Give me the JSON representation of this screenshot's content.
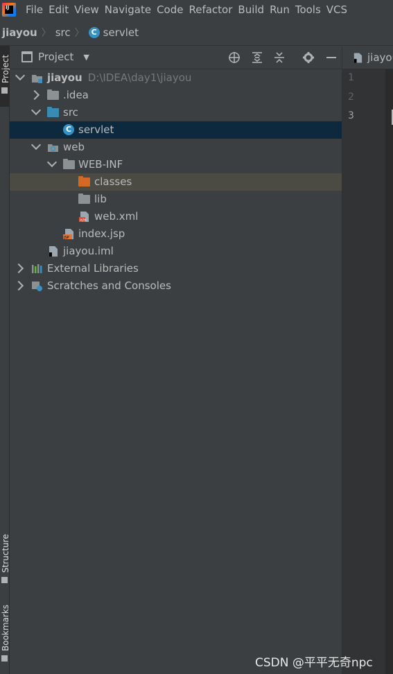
{
  "menubar": {
    "items": [
      {
        "label": "File"
      },
      {
        "label": "Edit"
      },
      {
        "label": "View"
      },
      {
        "label": "Navigate"
      },
      {
        "label": "Code"
      },
      {
        "label": "Refactor"
      },
      {
        "label": "Build"
      },
      {
        "label": "Run"
      },
      {
        "label": "Tools"
      },
      {
        "label": "VCS"
      }
    ]
  },
  "breadcrumb": {
    "project": "jiayou",
    "folder": "src",
    "file": "servlet"
  },
  "side_tabs": {
    "project": "Project",
    "structure": "Structure",
    "bookmarks": "Bookmarks"
  },
  "project_panel": {
    "title": "Project",
    "toolbar_icons": [
      "crosshair-icon",
      "expand-all-icon",
      "collapse-all-icon",
      "gear-icon",
      "minimize-icon"
    ]
  },
  "tree": {
    "root": {
      "label": "jiayou",
      "path": "D:\\IDEA\\day1\\jiayou"
    },
    "idea": ".idea",
    "src": "src",
    "servlet": "servlet",
    "web": "web",
    "webinf": "WEB-INF",
    "classes": "classes",
    "lib": "lib",
    "webxml": "web.xml",
    "indexjsp": "index.jsp",
    "iml": "jiayou.iml",
    "ext_libs": "External Libraries",
    "scratches": "Scratches and Consoles"
  },
  "editor": {
    "tab_label": "jiayou",
    "line_numbers": [
      "1",
      "2",
      "3"
    ]
  },
  "watermark": "CSDN @平平无奇npc"
}
